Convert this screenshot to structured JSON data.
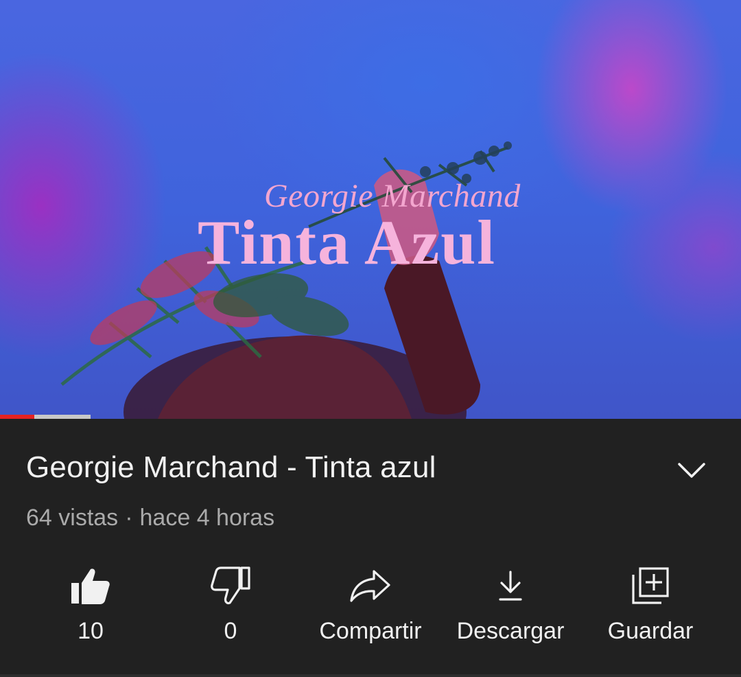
{
  "video": {
    "overlay_artist": "Georgie Marchand",
    "overlay_title": "Tinta Azul",
    "progress": 0.38
  },
  "info": {
    "title": "Georgie Marchand - Tinta azul",
    "views": "64 vistas",
    "separator": "·",
    "age": "hace 4 horas"
  },
  "actions": {
    "like_count": "10",
    "dislike_count": "0",
    "share_label": "Compartir",
    "download_label": "Descargar",
    "save_label": "Guardar"
  },
  "icons": {
    "like": "thumbs-up-icon",
    "dislike": "thumbs-down-icon",
    "share": "share-arrow-icon",
    "download": "download-icon",
    "save": "add-to-playlist-icon",
    "expand": "chevron-down-icon"
  },
  "colors": {
    "background": "#212121",
    "text": "#f1f1f1",
    "secondary_text": "#aaaaaa",
    "progress_played": "#e52222",
    "overlay_text": "#f6b3dc"
  }
}
